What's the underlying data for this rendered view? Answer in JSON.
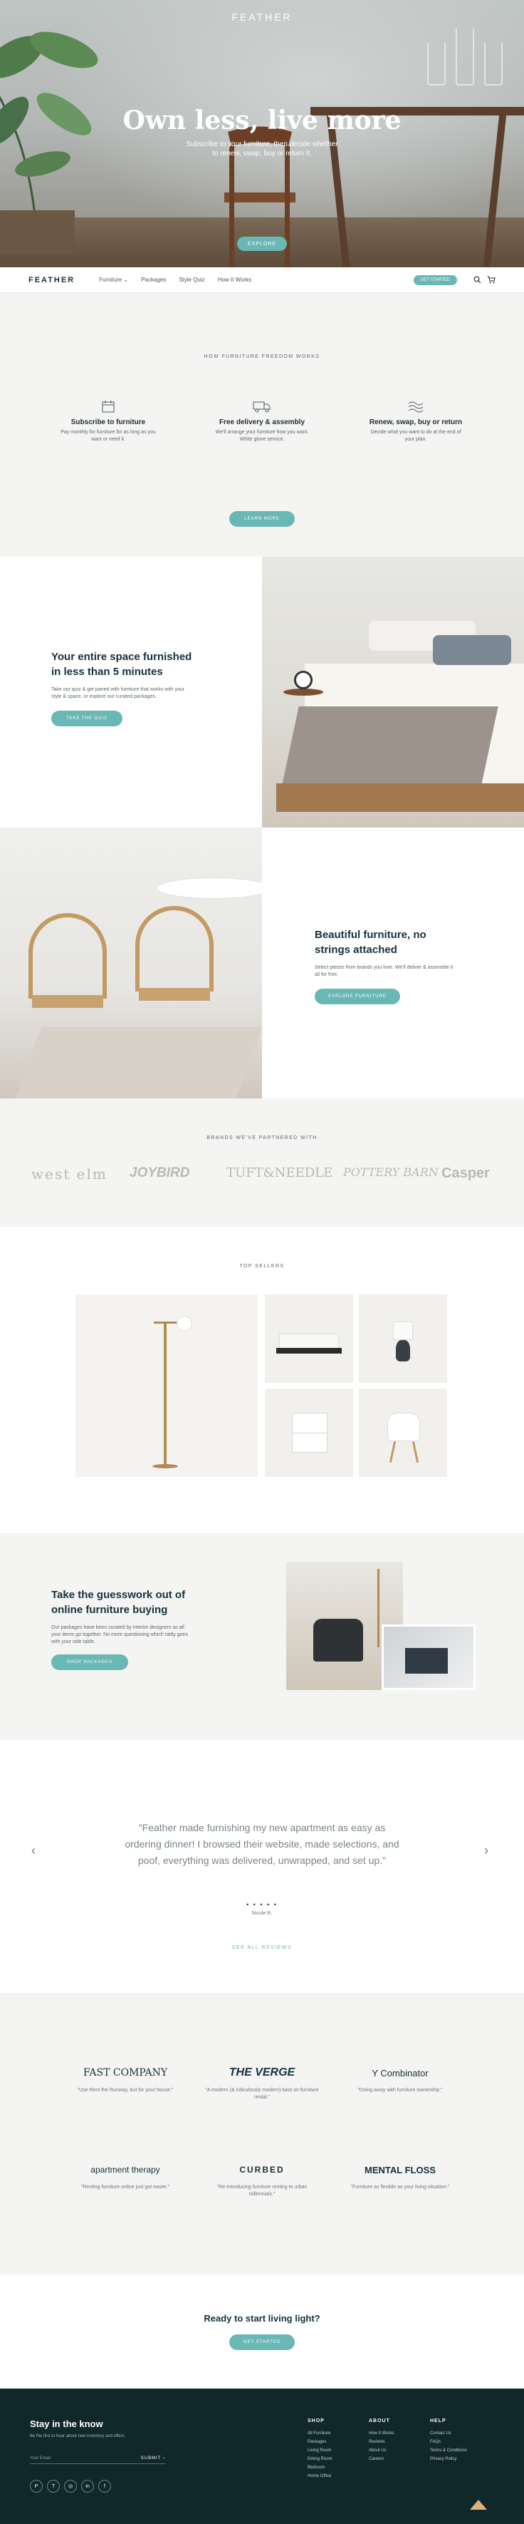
{
  "hero": {
    "brand": "FEATHER",
    "title": "Own less, live more",
    "subtitle": "Subscribe to your furniture, then decide whether to renew, swap, buy or return it.",
    "cta": "EXPLORE"
  },
  "nav": {
    "logo": "FEATHER",
    "links": [
      "Furniture ⌄",
      "Packages",
      "Style Quiz",
      "How It Works"
    ],
    "cta": "GET STARTED",
    "search_icon": "search-icon",
    "cart_icon": "cart-icon"
  },
  "how": {
    "eyebrow": "HOW FURNITURE FREEDOM WORKS",
    "steps": [
      {
        "icon": "calendar-icon",
        "title": "Subscribe to furniture",
        "text": "Pay monthly for furniture for as long as you want or need it."
      },
      {
        "icon": "truck-icon",
        "title": "Free delivery & assembly",
        "text": "We'll arrange your furniture how you want. White glove service."
      },
      {
        "icon": "waves-icon",
        "title": "Renew, swap, buy or return",
        "text": "Decide what you want to do at the end of your plan."
      }
    ],
    "cta": "LEARN MORE"
  },
  "split1": {
    "title": "Your entire space furnished in less than 5 minutes",
    "text": "Take our quiz & get paired with furniture that works with your style & space, or explore our curated packages.",
    "cta": "TAKE THE QUIZ"
  },
  "split2": {
    "title": "Beautiful furniture, no strings attached",
    "text": "Select pieces from brands you love. We'll deliver & assemble it all for free.",
    "cta": "EXPLORE FURNITURE"
  },
  "brands": {
    "eyebrow": "BRANDS WE'VE PARTNERED WITH",
    "items": [
      "west elm",
      "JOYBIRD",
      "TUFT&NEEDLE",
      "POTTERY BARN",
      "Casper"
    ]
  },
  "sellers": {
    "eyebrow": "TOP SELLERS"
  },
  "guess": {
    "title": "Take the guesswork out of online furniture buying",
    "text": "Our packages have been curated by interior designers so all your items go together. No more questioning which rattly goes with your side table.",
    "cta": "SHOP PACKAGES"
  },
  "testimonial": {
    "quote": "\"Feather made furnishing my new apartment as easy as ordering dinner! I browsed their website, made selections, and poof, everything was delivered, unwrapped, and set up.\"",
    "dots": "• • • • •",
    "author": "Nicole R.",
    "all_reviews": "SEE ALL REVIEWS",
    "prev": "‹",
    "next": "›"
  },
  "press": [
    {
      "logo": "FAST COMPANY",
      "quote": "\"Use Rent the Runway, but for your house.\""
    },
    {
      "logo": "THE VERGE",
      "quote": "\"A modern (& ridiculously modern) twist on furniture rental.\""
    },
    {
      "logo": "Y Combinator",
      "quote": "\"Doing away with furniture ownership.\""
    },
    {
      "logo": "apartment therapy",
      "quote": "\"Renting furniture online just got easier.\""
    },
    {
      "logo": "CURBED",
      "quote": "\"Re-introducing furniture renting to urban millennials.\""
    },
    {
      "logo": "MENTAL FLOSS",
      "quote": "\"Furniture as flexible as your living situation.\""
    }
  ],
  "ready": {
    "title": "Ready to start living light?",
    "cta": "GET STARTED"
  },
  "footer": {
    "title": "Stay in the know",
    "sub": "Be the first to hear about new inventory and offers.",
    "email_placeholder": "Your Email",
    "submit": "SUBMIT ›",
    "social": [
      "P",
      "T",
      "◎",
      "in",
      "f"
    ],
    "shop": {
      "heading": "SHOP",
      "links": [
        "All Furniture",
        "Packages",
        "Living Room",
        "Dining Room",
        "Bedroom",
        "Home Office"
      ]
    },
    "about": {
      "heading": "ABOUT",
      "links": [
        "How It Works",
        "Reviews",
        "About Us",
        "Careers"
      ]
    },
    "help": {
      "heading": "HELP",
      "links": [
        "Contact Us",
        "FAQs",
        "Terms & Conditions",
        "Privacy Policy"
      ]
    }
  },
  "colors": {
    "accent": "#6ab8b5",
    "dark": "#16313c",
    "footer": "#10282a",
    "light_bg": "#f4f4f2"
  }
}
